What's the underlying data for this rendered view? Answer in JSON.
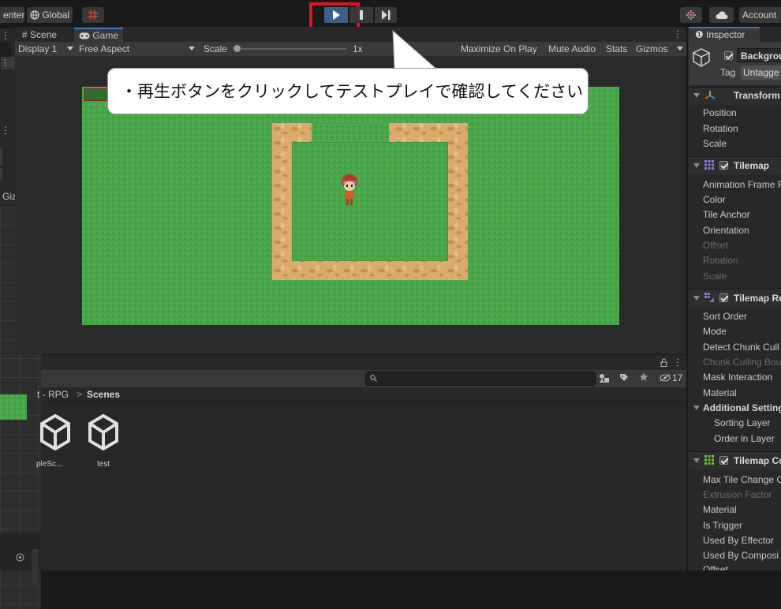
{
  "toolbar": {
    "center_label": "enter",
    "global_label": "Global",
    "account_label": "Account"
  },
  "game_view": {
    "tabs": [
      {
        "label": "Scene"
      },
      {
        "label": "Game"
      }
    ],
    "display": "Display 1",
    "aspect": "Free Aspect",
    "scale_label": "Scale",
    "scale_value": "1x",
    "maximize": "Maximize On Play",
    "mute": "Mute Audio",
    "stats": "Stats",
    "gizmos": "Gizmos"
  },
  "annotation": {
    "text": "・再生ボタンをクリックしてテストプレイで確認してください",
    "highlight_color": "#e0141e"
  },
  "scene_panel": {
    "gizmos": "Gizmos"
  },
  "project": {
    "breadcrumb_part1": "t - RPG",
    "breadcrumb_sep": ">",
    "breadcrumb_part2": "Scenes",
    "hidden_count": "17",
    "assets": [
      {
        "label": "pleSc..."
      },
      {
        "label": "test"
      }
    ]
  },
  "inspector": {
    "tab": "Inspector",
    "object_name": "Backgrou",
    "tag_label": "Tag",
    "tag_value": "Untagge",
    "transform": {
      "title": "Transform",
      "rows": [
        "Position",
        "Rotation",
        "Scale"
      ]
    },
    "tilemap": {
      "title": "Tilemap",
      "rows": [
        "Animation Frame R",
        "Color",
        "Tile Anchor",
        "Orientation",
        "Offset",
        "Rotation",
        "Scale"
      ]
    },
    "renderer": {
      "title": "Tilemap Re",
      "rows": [
        "Sort Order",
        "Mode",
        "Detect Chunk Cull",
        "Chunk Culling Bou",
        "Mask Interaction",
        "Material"
      ],
      "additional": "Additional Setting",
      "sub_rows": [
        "Sorting Layer",
        "Order in Layer"
      ]
    },
    "collider": {
      "title": "Tilemap Co",
      "rows": [
        "Max Tile Change C",
        "Extrusion Factor",
        "Material",
        "Is Trigger",
        "Used By Effector",
        "Used By Composi",
        "Offset"
      ]
    }
  }
}
